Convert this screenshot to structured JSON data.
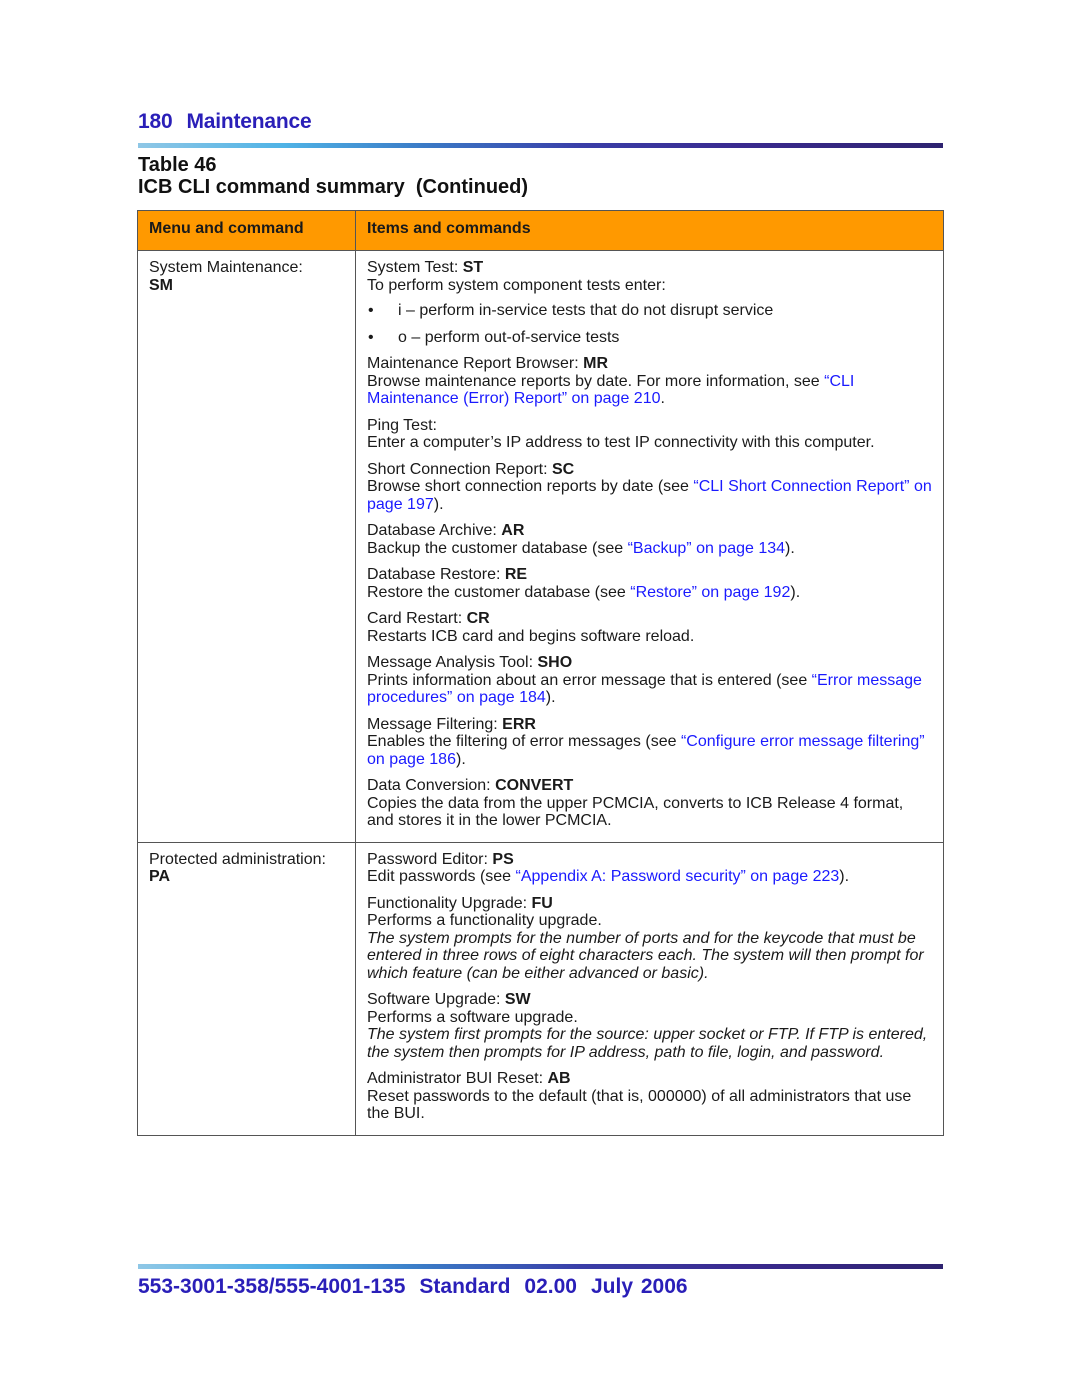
{
  "header": {
    "page_number": "180",
    "section_title": "Maintenance"
  },
  "caption": {
    "table_label": "Table 46",
    "table_title": "ICB CLI command summary  (Continued)"
  },
  "table": {
    "columns": [
      "Menu and command",
      "Items and commands"
    ],
    "rows": [
      {
        "menu_label": "System Maintenance:",
        "menu_code": "SM",
        "items": [
          {
            "title": "System Test: ",
            "code": "ST",
            "lines": [
              {
                "text": "To perform system component tests enter:"
              }
            ],
            "bullets": [
              "i – perform in-service tests that do not disrupt service",
              "o – perform out-of-service tests"
            ]
          },
          {
            "title": "Maintenance Report Browser: ",
            "code": "MR",
            "desc_pre": "Browse maintenance reports by date. For more information, see ",
            "desc_link": "“CLI Maintenance (Error) Report” on page 210",
            "desc_post": "."
          },
          {
            "title": "Ping Test:",
            "code": "",
            "desc_pre": "Enter a computer’s IP address to test IP connectivity with this computer.",
            "desc_link": "",
            "desc_post": ""
          },
          {
            "title": "Short Connection Report: ",
            "code": "SC",
            "desc_pre": "Browse short connection reports by date (see ",
            "desc_link": "“CLI Short Connection Report” on page 197",
            "desc_post": ")."
          },
          {
            "title": "Database Archive: ",
            "code": "AR",
            "desc_pre": "Backup the customer database (see ",
            "desc_link": "“Backup” on page 134",
            "desc_post": ")."
          },
          {
            "title": "Database Restore: ",
            "code": "RE",
            "desc_pre": "Restore the customer database (see ",
            "desc_link": "“Restore” on page 192",
            "desc_post": ")."
          },
          {
            "title": "Card Restart: ",
            "code": "CR",
            "desc_pre": "Restarts ICB card and begins software reload.",
            "desc_link": "",
            "desc_post": ""
          },
          {
            "title": "Message Analysis Tool: ",
            "code": "SHO",
            "desc_pre": "Prints information about an error message that is entered (see ",
            "desc_link": "“Error message procedures” on page 184",
            "desc_post": ")."
          },
          {
            "title": "Message Filtering: ",
            "code": "ERR",
            "desc_pre": "Enables the filtering of error messages (see ",
            "desc_link": "“Configure error message filtering” on page 186",
            "desc_post": ")."
          },
          {
            "title": "Data Conversion: ",
            "code": "CONVERT",
            "desc_pre": "Copies the data from the upper PCMCIA, converts to ICB Release 4 format, and stores it in the lower PCMCIA.",
            "desc_link": "",
            "desc_post": ""
          }
        ]
      },
      {
        "menu_label": "Protected administration:",
        "menu_code": "PA",
        "items": [
          {
            "title": "Password Editor: ",
            "code": "PS",
            "desc_pre": "Edit passwords (see ",
            "desc_link": "“Appendix A: Password security” on page 223",
            "desc_post": ")."
          },
          {
            "title": "Functionality Upgrade: ",
            "code": "FU",
            "desc_pre": "Performs a functionality upgrade.",
            "note": "The system prompts for the number of ports and for the keycode that must be entered in three rows of eight characters each. The system will then prompt for which feature (can be either advanced or basic)."
          },
          {
            "title": "Software Upgrade: ",
            "code": "SW",
            "desc_pre": "Performs a software upgrade.",
            "note": "The system first prompts for the source: upper socket or FTP. If FTP is entered, the system then prompts for IP address, path to file, login, and password."
          },
          {
            "title": "Administrator BUI Reset: ",
            "code": "AB",
            "desc_pre": "Reset passwords to the default (that is, 000000) of all administrators that use the BUI."
          }
        ]
      }
    ]
  },
  "footer": {
    "doc_number": "553-3001-358/555-4001-135",
    "status": "Standard",
    "version": "02.00",
    "date": "July 2006"
  },
  "colors": {
    "heading_blue": "#2a1fb8",
    "header_orange": "#ff9900",
    "link_blue": "#1a1aff"
  }
}
